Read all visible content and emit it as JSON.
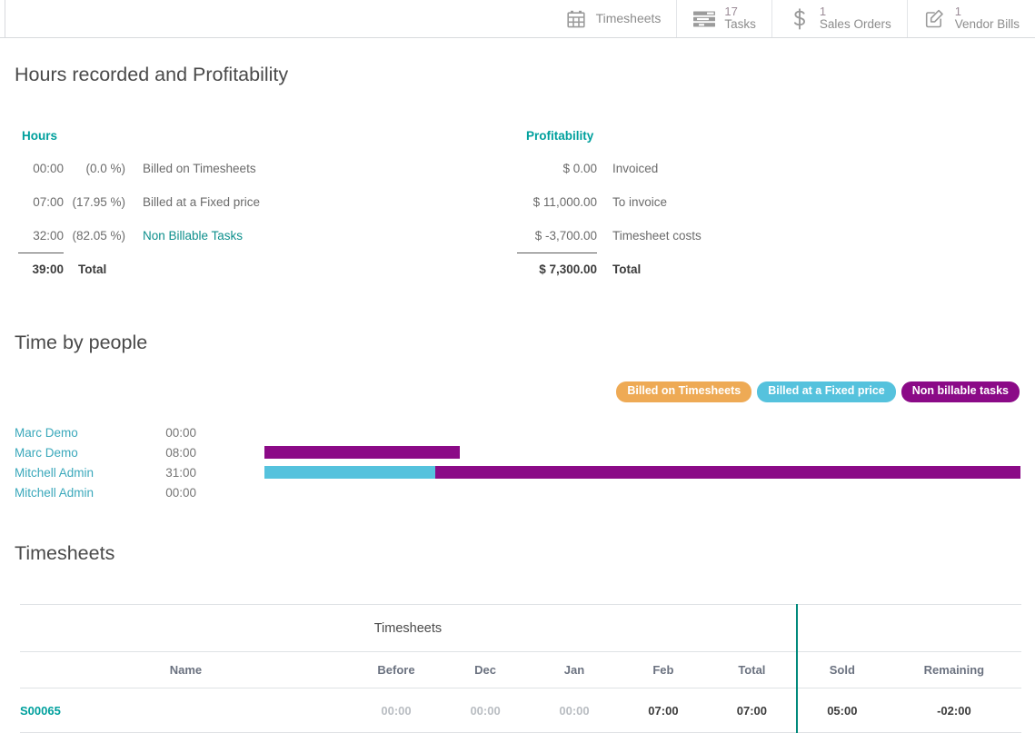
{
  "statbar": {
    "items": [
      {
        "icon": "calendar-icon",
        "value": "",
        "label": "Timesheets"
      },
      {
        "icon": "tasks-list-icon",
        "value": "17",
        "label": "Tasks"
      },
      {
        "icon": "dollar-icon",
        "value": "1",
        "label": "Sales Orders"
      },
      {
        "icon": "edit-pencil-icon",
        "value": "1",
        "label": "Vendor Bills"
      }
    ]
  },
  "hours_profitability": {
    "title": "Hours recorded and Profitability",
    "hours": {
      "heading": "Hours",
      "rows": [
        {
          "value": "00:00",
          "percent": "(0.0 %)",
          "label": "Billed on Timesheets",
          "is_link": false
        },
        {
          "value": "07:00",
          "percent": "(17.95 %)",
          "label": "Billed at a Fixed price",
          "is_link": false
        },
        {
          "value": "32:00",
          "percent": "(82.05 %)",
          "label": "Non Billable Tasks",
          "is_link": true
        }
      ],
      "total": {
        "value": "39:00",
        "label": "Total"
      }
    },
    "profitability": {
      "heading": "Profitability",
      "rows": [
        {
          "value": "$ 0.00",
          "label": "Invoiced"
        },
        {
          "value": "$ 11,000.00",
          "label": "To invoice"
        },
        {
          "value": "$ -3,700.00",
          "label": "Timesheet costs"
        }
      ],
      "total": {
        "value": "$ 7,300.00",
        "label": "Total"
      }
    }
  },
  "time_by_people": {
    "title": "Time by people",
    "legend": [
      {
        "label": "Billed on Timesheets",
        "color": "#eeaa55"
      },
      {
        "label": "Billed at a Fixed price",
        "color": "#55c2dd"
      },
      {
        "label": "Non billable tasks",
        "color": "#8b0a87"
      }
    ],
    "rows": [
      {
        "name": "Marc Demo",
        "value": "00:00",
        "segments": []
      },
      {
        "name": "Marc Demo",
        "value": "08:00",
        "segments": [
          {
            "series": "Non billable tasks",
            "color": "#8b0a87",
            "hours": 8
          }
        ]
      },
      {
        "name": "Mitchell Admin",
        "value": "31:00",
        "segments": [
          {
            "series": "Billed at a Fixed price",
            "color": "#55c2dd",
            "hours": 7
          },
          {
            "series": "Non billable tasks",
            "color": "#8b0a87",
            "hours": 24
          }
        ]
      },
      {
        "name": "Mitchell Admin",
        "value": "00:00",
        "segments": []
      }
    ],
    "axis_max_hours": 31
  },
  "timesheets": {
    "title": "Timesheets",
    "group_header": "Timesheets",
    "columns": [
      "Name",
      "Before",
      "Dec",
      "Jan",
      "Feb",
      "Total",
      "Sold",
      "Remaining"
    ],
    "rows": [
      {
        "name": "S00065",
        "before": "00:00",
        "dec": "00:00",
        "jan": "00:00",
        "feb": "07:00",
        "total": "07:00",
        "sold": "05:00",
        "remaining": "-02:00",
        "muted": [
          "before",
          "dec",
          "jan"
        ]
      }
    ]
  },
  "colors": {
    "teal": "#00a09d",
    "divider_teal": "#00897b",
    "link_blue": "#3aa8bb",
    "border": "#dfe2e5"
  }
}
